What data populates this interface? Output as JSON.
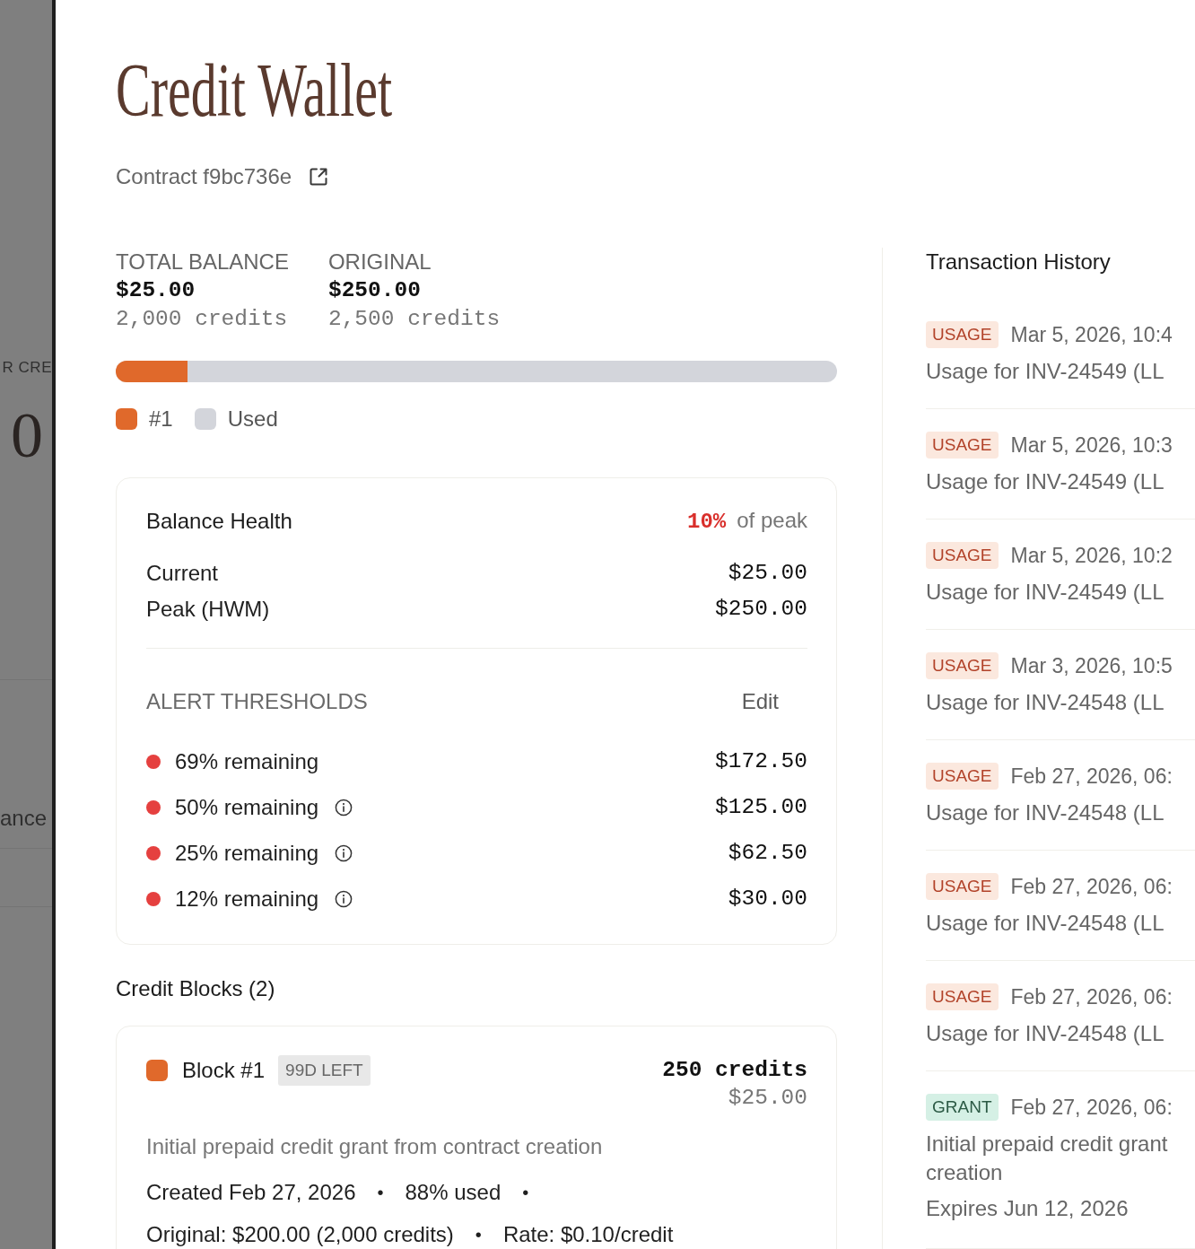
{
  "backdrop": {
    "heading_fragment": "R CRE",
    "amount_fragment": "0",
    "row_fragment": "ance"
  },
  "header": {
    "title": "Credit Wallet",
    "contract": "Contract f9bc736e"
  },
  "totals": [
    {
      "label": "TOTAL BALANCE",
      "value": "$25.00",
      "credits": "2,000 credits"
    },
    {
      "label": "ORIGINAL",
      "value": "$250.00",
      "credits": "2,500 credits"
    }
  ],
  "balance_bar": {
    "level": 0.1
  },
  "legend": [
    {
      "label": "#1",
      "color": "#e0692b"
    },
    {
      "label": "Used",
      "color": "#d3d5db"
    }
  ],
  "health": {
    "title": "Balance Health",
    "percent": "10%",
    "percent_suffix": "of peak",
    "rows": [
      {
        "label": "Current",
        "value": "$25.00"
      },
      {
        "label": "Peak (HWM)",
        "value": "$250.00"
      }
    ],
    "alerts_heading": "ALERT THRESHOLDS",
    "edit": "Edit",
    "thresholds": [
      {
        "label": "69% remaining",
        "triggered": true,
        "info": false,
        "amount": "$172.50"
      },
      {
        "label": "50% remaining",
        "triggered": true,
        "info": true,
        "amount": "$125.00"
      },
      {
        "label": "25% remaining",
        "triggered": true,
        "info": true,
        "amount": "$62.50"
      },
      {
        "label": "12% remaining",
        "triggered": true,
        "info": true,
        "amount": "$30.00"
      }
    ]
  },
  "credit_blocks": {
    "heading": "Credit Blocks (2)",
    "blocks": [
      {
        "color": "#e0692b",
        "name": "Block #1",
        "badge": "99D LEFT",
        "credits": "250 credits",
        "amount": "$25.00",
        "description": "Initial prepaid credit grant from contract creation",
        "meta_lines": [
          [
            "Created Feb 27, 2026",
            "•",
            "88% used",
            "•"
          ],
          [
            "Original: $200.00 (2,000 credits)",
            "•",
            "Rate: $0.10/credit"
          ]
        ]
      }
    ]
  },
  "transactions": {
    "heading": "Transaction History",
    "items": [
      {
        "kind": "usage",
        "badge": "USAGE",
        "date": "Mar 5, 2026, 10:4",
        "description_lines": [
          "Usage for INV-24549 (LL"
        ]
      },
      {
        "kind": "usage",
        "badge": "USAGE",
        "date": "Mar 5, 2026, 10:3",
        "description_lines": [
          "Usage for INV-24549 (LL"
        ]
      },
      {
        "kind": "usage",
        "badge": "USAGE",
        "date": "Mar 5, 2026, 10:2",
        "description_lines": [
          "Usage for INV-24549 (LL"
        ]
      },
      {
        "kind": "usage",
        "badge": "USAGE",
        "date": "Mar 3, 2026, 10:5",
        "description_lines": [
          "Usage for INV-24548 (LL"
        ]
      },
      {
        "kind": "usage",
        "badge": "USAGE",
        "date": "Feb 27, 2026, 06:",
        "description_lines": [
          "Usage for INV-24548 (LL"
        ]
      },
      {
        "kind": "usage",
        "badge": "USAGE",
        "date": "Feb 27, 2026, 06:",
        "description_lines": [
          "Usage for INV-24548 (LL"
        ]
      },
      {
        "kind": "usage",
        "badge": "USAGE",
        "date": "Feb 27, 2026, 06:",
        "description_lines": [
          "Usage for INV-24548 (LL"
        ]
      },
      {
        "kind": "grant",
        "badge": "GRANT",
        "date": "Feb 27, 2026, 06:",
        "description_lines": [
          "Initial prepaid credit grant",
          "creation"
        ],
        "expires": "Expires Jun 12, 2026"
      }
    ]
  }
}
